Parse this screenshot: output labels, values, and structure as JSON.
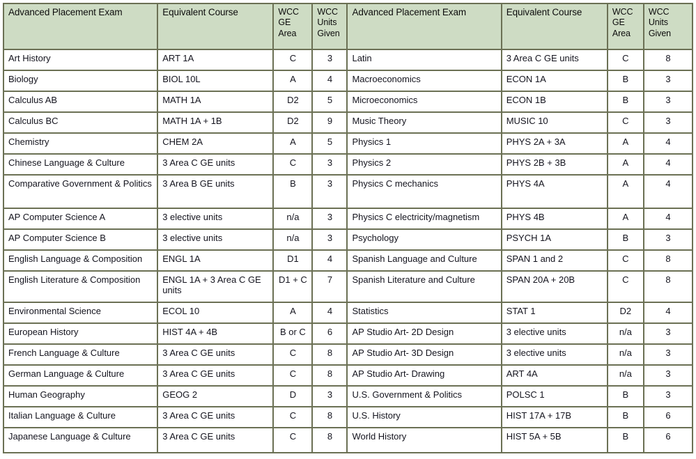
{
  "table": {
    "headers_left": {
      "exam": "Advanced Placement Exam",
      "course": "Equivalent Course",
      "ge_area": "WCC\nGE\nArea",
      "ge_area_line1": "WCC",
      "ge_area_line2": "GE",
      "ge_area_line3": "Area",
      "units_line1": "WCC",
      "units_line2": "Units",
      "units_line3": "Given"
    },
    "headers_right": {
      "exam": "Advanced Placement Exam",
      "course": "Equivalent Course",
      "ge_area_line1": "WCC",
      "ge_area_line2": "GE",
      "ge_area_line3": "Area",
      "units_line1": "WCC",
      "units_line2": "Units",
      "units_line3": "Given"
    },
    "colors": {
      "header_background": "#cedcc4",
      "border": "#6b7054",
      "text": "#14141e",
      "cell_background": "#ffffff"
    },
    "rows": [
      {
        "left": {
          "exam": "Art History",
          "course": "ART 1A",
          "ge": "C",
          "units": "3"
        },
        "right": {
          "exam": "Latin",
          "course": "3 Area C GE units",
          "ge": "C",
          "units": "8"
        },
        "height": "std"
      },
      {
        "left": {
          "exam": "Biology",
          "course": "BIOL 10L",
          "ge": "A",
          "units": "4"
        },
        "right": {
          "exam": "Macroeconomics",
          "course": "ECON 1A",
          "ge": "B",
          "units": "3"
        },
        "height": "std"
      },
      {
        "left": {
          "exam": "Calculus AB",
          "course": "MATH 1A",
          "ge": "D2",
          "units": "5"
        },
        "right": {
          "exam": "Microeconomics",
          "course": "ECON 1B",
          "ge": "B",
          "units": "3"
        },
        "height": "std"
      },
      {
        "left": {
          "exam": "Calculus BC",
          "course": "MATH 1A + 1B",
          "ge": "D2",
          "units": "9"
        },
        "right": {
          "exam": "Music Theory",
          "course": "MUSIC 10",
          "ge": "C",
          "units": "3"
        },
        "height": "std"
      },
      {
        "left": {
          "exam": "Chemistry",
          "course": "CHEM 2A",
          "ge": "A",
          "units": "5"
        },
        "right": {
          "exam": "Physics 1",
          "course": "PHYS 2A + 3A",
          "ge": "A",
          "units": "4"
        },
        "height": "std"
      },
      {
        "left": {
          "exam": "Chinese Language & Culture",
          "course": "3 Area C GE units",
          "ge": "C",
          "units": "3"
        },
        "right": {
          "exam": "Physics 2",
          "course": "PHYS 2B + 3B",
          "ge": "A",
          "units": "4"
        },
        "height": "std"
      },
      {
        "left": {
          "exam": "Comparative Government & Politics",
          "course": "3 Area B GE units",
          "ge": "B",
          "units": "3"
        },
        "right": {
          "exam": "Physics C mechanics",
          "course": "PHYS 4A",
          "ge": "A",
          "units": "4"
        },
        "height": "tall"
      },
      {
        "left": {
          "exam": "AP Computer Science A",
          "course": "3 elective units",
          "ge": "n/a",
          "units": "3"
        },
        "right": {
          "exam": "Physics C electricity/magnetism",
          "course": "PHYS 4B",
          "ge": "A",
          "units": "4"
        },
        "height": "std"
      },
      {
        "left": {
          "exam": "AP Computer Science B",
          "course": "3 elective units",
          "ge": "n/a",
          "units": "3"
        },
        "right": {
          "exam": "Psychology",
          "course": "PSYCH 1A",
          "ge": "B",
          "units": "3"
        },
        "height": "std"
      },
      {
        "left": {
          "exam": "English Language & Composition",
          "course": "ENGL 1A",
          "ge": "D1",
          "units": "4"
        },
        "right": {
          "exam": "Spanish Language and Culture",
          "course": "SPAN 1 and 2",
          "ge": "C",
          "units": "8"
        },
        "height": "std"
      },
      {
        "left": {
          "exam": "English Literature & Composition",
          "course": "ENGL 1A + 3 Area C GE units",
          "ge": "D1 + C",
          "units": "7"
        },
        "right": {
          "exam": "Spanish Literature and Culture",
          "course": "SPAN  20A + 20B",
          "ge": "C",
          "units": "8"
        },
        "height": "tall2"
      },
      {
        "left": {
          "exam": "Environmental Science",
          "course": "ECOL 10",
          "ge": "A",
          "units": "4"
        },
        "right": {
          "exam": "Statistics",
          "course": "STAT 1",
          "ge": "D2",
          "units": "4"
        },
        "height": "std"
      },
      {
        "left": {
          "exam": "European History",
          "course": "HIST 4A + 4B",
          "ge": "B or C",
          "units": "6"
        },
        "right": {
          "exam": "AP Studio Art- 2D Design",
          "course": "3 elective units",
          "ge": "n/a",
          "units": "3"
        },
        "height": "std"
      },
      {
        "left": {
          "exam": "French Language & Culture",
          "course": "3 Area C GE units",
          "ge": "C",
          "units": "8"
        },
        "right": {
          "exam": "AP Studio Art- 3D Design",
          "course": "3 elective units",
          "ge": "n/a",
          "units": "3"
        },
        "height": "std"
      },
      {
        "left": {
          "exam": "German Language & Culture",
          "course": "3 Area C GE units",
          "ge": "C",
          "units": "8"
        },
        "right": {
          "exam": "AP Studio Art- Drawing",
          "course": "ART 4A",
          "ge": "n/a",
          "units": "3"
        },
        "height": "std"
      },
      {
        "left": {
          "exam": "Human Geography",
          "course": "GEOG 2",
          "ge": "D",
          "units": "3"
        },
        "right": {
          "exam": "U.S. Government & Politics",
          "course": "POLSC 1",
          "ge": "B",
          "units": "3"
        },
        "height": "std"
      },
      {
        "left": {
          "exam": "Italian Language & Culture",
          "course": "3 Area C GE units",
          "ge": "C",
          "units": "8"
        },
        "right": {
          "exam": "U.S. History",
          "course": "HIST 17A + 17B",
          "ge": "B",
          "units": "6"
        },
        "height": "std"
      },
      {
        "left": {
          "exam": "Japanese Language & Culture",
          "course": "3 Area C GE units",
          "ge": "C",
          "units": "8"
        },
        "right": {
          "exam": "World History",
          "course": "HIST 5A + 5B",
          "ge": "B",
          "units": "6"
        },
        "height": "last"
      }
    ]
  }
}
